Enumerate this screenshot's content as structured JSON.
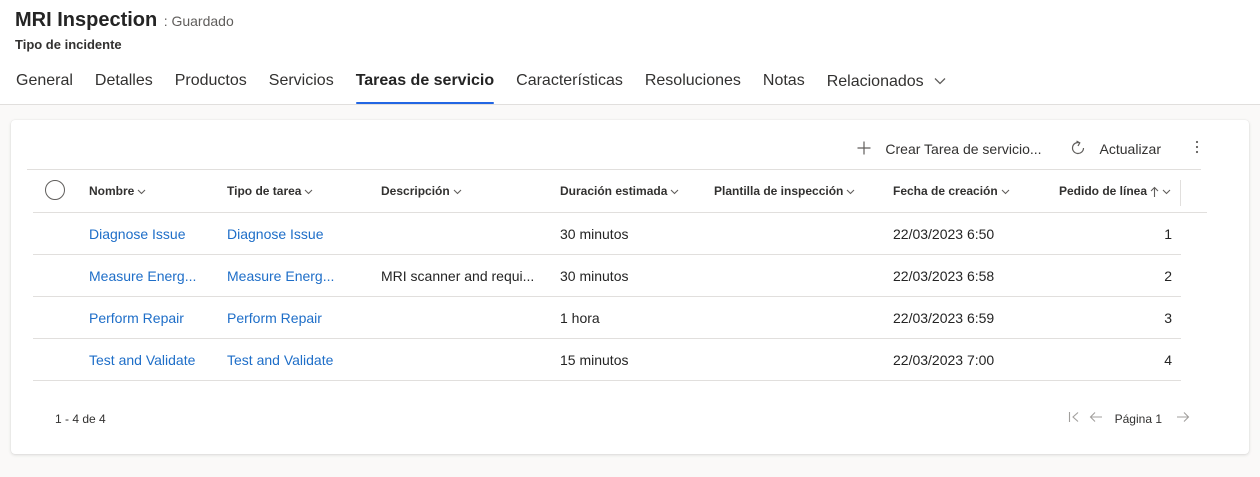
{
  "header": {
    "title": "MRI Inspection",
    "status": ": Guardado",
    "entity_type": "Tipo de incidente"
  },
  "tabs": [
    {
      "label": "General"
    },
    {
      "label": "Detalles"
    },
    {
      "label": "Productos"
    },
    {
      "label": "Servicios"
    },
    {
      "label": "Tareas de servicio",
      "active": true
    },
    {
      "label": "Características"
    },
    {
      "label": "Resoluciones"
    },
    {
      "label": "Notas"
    },
    {
      "label": "Relacionados",
      "dropdown": true
    }
  ],
  "toolbar": {
    "create_label": "Crear Tarea de servicio...",
    "refresh_label": "Actualizar"
  },
  "grid": {
    "columns": [
      {
        "label": "Nombre",
        "sort": "none"
      },
      {
        "label": "Tipo de tarea",
        "sort": "none"
      },
      {
        "label": "Descripción",
        "sort": "none"
      },
      {
        "label": "Duración estimada",
        "sort": "none"
      },
      {
        "label": "Plantilla de inspección",
        "sort": "none"
      },
      {
        "label": "Fecha de creación",
        "sort": "none"
      },
      {
        "label": "Pedido de línea",
        "sort": "ascending"
      }
    ],
    "rows": [
      {
        "name": "Diagnose Issue",
        "task_type": "Diagnose Issue",
        "description": "",
        "duration": "30 minutos",
        "template": "",
        "created": "22/03/2023 6:50",
        "line_order": "1"
      },
      {
        "name": "Measure Energ...",
        "task_type": "Measure Energ...",
        "description": "MRI scanner and requi...",
        "duration": "30 minutos",
        "template": "",
        "created": "22/03/2023 6:58",
        "line_order": "2"
      },
      {
        "name": "Perform Repair",
        "task_type": "Perform Repair",
        "description": "",
        "duration": "1 hora",
        "template": "",
        "created": "22/03/2023 6:59",
        "line_order": "3"
      },
      {
        "name": "Test and Validate",
        "task_type": "Test and Validate",
        "description": "",
        "duration": "15 minutos",
        "template": "",
        "created": "22/03/2023 7:00",
        "line_order": "4"
      }
    ]
  },
  "footer": {
    "count_text": "1 - 4 de 4",
    "page_label": "Página 1"
  },
  "colors": {
    "accent": "#2266e3",
    "link": "#1e6ec8",
    "background": "#faf9f8",
    "border": "#e1dfdd"
  },
  "icons": [
    "add-icon",
    "refresh-icon",
    "more-vertical-icon",
    "chevron-down-icon",
    "sort-ascending-icon",
    "first-page-icon",
    "previous-page-icon",
    "next-page-icon"
  ]
}
